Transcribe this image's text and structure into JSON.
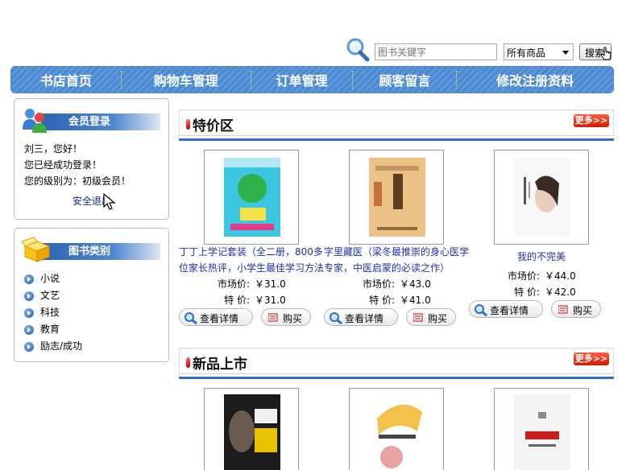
{
  "search": {
    "placeholder": "图书关键字",
    "category_selected": "所有商品",
    "button_label": "搜索"
  },
  "nav": {
    "items": [
      "书店首页",
      "购物车管理",
      "订单管理",
      "顾客留言",
      "修改注册资料"
    ]
  },
  "login_box": {
    "title": "会员登录",
    "greeting": "刘三，您好！",
    "status": "您已经成功登录！",
    "level": "您的级别为：初级会员！",
    "logout": "安全退出"
  },
  "category_box": {
    "title": "图书类别",
    "items": [
      "小说",
      "文艺",
      "科技",
      "教育",
      "励志/成功"
    ]
  },
  "labels": {
    "market_price": "市场价:",
    "special_price": "特  价:",
    "detail_button": "查看详情",
    "buy_button": "购买",
    "more": "更多>>"
  },
  "special_section": {
    "title": "特价区",
    "products": [
      {
        "name": "丁丁上学记套装（全二册，800多位家长热评，小学生最佳学习方法",
        "market_price": "￥31.0",
        "special_price": "￥31.0"
      },
      {
        "name": "字里藏医（梁冬最推崇的身心医学专家，中医启蒙的必读之作）",
        "market_price": "￥43.0",
        "special_price": "￥41.0"
      },
      {
        "name": "我的不完美",
        "market_price": "￥44.0",
        "special_price": "￥42.0"
      }
    ]
  },
  "new_section": {
    "title": "新品上市"
  },
  "colors": {
    "nav_blue": "#5c97d9",
    "link_blue": "#1c33a8",
    "accent_red": "#d21c00",
    "section_line": "#2f6fc4"
  }
}
